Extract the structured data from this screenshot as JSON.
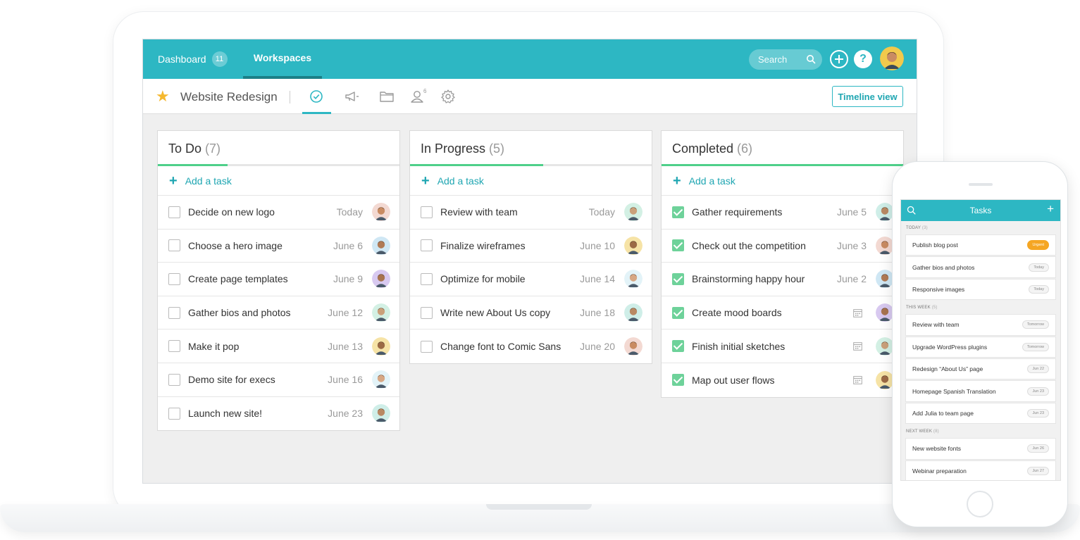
{
  "topbar": {
    "dashboard_label": "Dashboard",
    "dashboard_count": "11",
    "workspaces_label": "Workspaces",
    "search_placeholder": "Search",
    "help_label": "?"
  },
  "project": {
    "title": "Website Redesign",
    "members_count": "6",
    "timeline_button": "Timeline view"
  },
  "icons": {
    "favorite": "star-icon",
    "tasks_tab": "check-circle-icon",
    "announcements_tab": "megaphone-icon",
    "files_tab": "folder-icon",
    "members_tab": "user-icon",
    "settings_tab": "gear-icon",
    "search": "search-icon",
    "add": "plus-circle-icon",
    "help": "question-icon",
    "calendar": "calendar-icon"
  },
  "colors": {
    "brand": "#2db7c3",
    "progress": "#4fd08a",
    "checked": "#6ed29a",
    "star": "#f5b82e",
    "urgent": "#f5a623"
  },
  "columns": [
    {
      "title": "To Do",
      "count": "(7)",
      "progress": 0.29,
      "add_label": "Add a task",
      "tasks": [
        {
          "name": "Decide on new logo",
          "date": "Today",
          "done": false
        },
        {
          "name": "Choose a hero image",
          "date": "June 6",
          "done": false
        },
        {
          "name": "Create page templates",
          "date": "June 9",
          "done": false
        },
        {
          "name": "Gather bios and photos",
          "date": "June 12",
          "done": false
        },
        {
          "name": "Make it pop",
          "date": "June 13",
          "done": false
        },
        {
          "name": "Demo site for execs",
          "date": "June 16",
          "done": false
        },
        {
          "name": "Launch new site!",
          "date": "June 23",
          "done": false
        }
      ]
    },
    {
      "title": "In Progress",
      "count": "(5)",
      "progress": 0.55,
      "add_label": "Add a task",
      "tasks": [
        {
          "name": "Review with team",
          "date": "Today",
          "done": false
        },
        {
          "name": "Finalize wireframes",
          "date": "June 10",
          "done": false
        },
        {
          "name": "Optimize for mobile",
          "date": "June 14",
          "done": false
        },
        {
          "name": "Write new About Us copy",
          "date": "June 18",
          "done": false
        },
        {
          "name": "Change font to Comic Sans",
          "date": "June 20",
          "done": false
        }
      ]
    },
    {
      "title": "Completed",
      "count": "(6)",
      "progress": 1.0,
      "add_label": "Add a task",
      "tasks": [
        {
          "name": "Gather requirements",
          "date": "June 5",
          "done": true
        },
        {
          "name": "Check out the competition",
          "date": "June 3",
          "done": true
        },
        {
          "name": "Brainstorming happy hour",
          "date": "June 2",
          "done": true
        },
        {
          "name": "Create mood boards",
          "date": "",
          "done": true
        },
        {
          "name": "Finish initial sketches",
          "date": "",
          "done": true
        },
        {
          "name": "Map out user flows",
          "date": "",
          "done": true
        }
      ]
    }
  ],
  "phone": {
    "title": "Tasks",
    "sections": [
      {
        "label": "TODAY",
        "count": "(3)",
        "items": [
          {
            "name": "Publish blog post",
            "tag": "Urgent",
            "urgent": true
          },
          {
            "name": "Gather bios and photos",
            "tag": "Today",
            "urgent": false
          },
          {
            "name": "Responsive images",
            "tag": "Today",
            "urgent": false
          }
        ]
      },
      {
        "label": "THIS WEEK",
        "count": "(5)",
        "items": [
          {
            "name": "Review with team",
            "tag": "Tomorrow",
            "urgent": false
          },
          {
            "name": "Upgrade WordPress plugins",
            "tag": "Tomorrow",
            "urgent": false
          },
          {
            "name": "Redesign “About Us” page",
            "tag": "Jun 22",
            "urgent": false
          },
          {
            "name": "Homepage Spanish Translation",
            "tag": "Jun 23",
            "urgent": false
          },
          {
            "name": "Add Julia to team page",
            "tag": "Jun 23",
            "urgent": false
          }
        ]
      },
      {
        "label": "NEXT WEEK",
        "count": "(8)",
        "items": [
          {
            "name": "New website fonts",
            "tag": "Jun 26",
            "urgent": false
          },
          {
            "name": "Webinar preparation",
            "tag": "Jun 27",
            "urgent": false
          }
        ]
      }
    ]
  }
}
